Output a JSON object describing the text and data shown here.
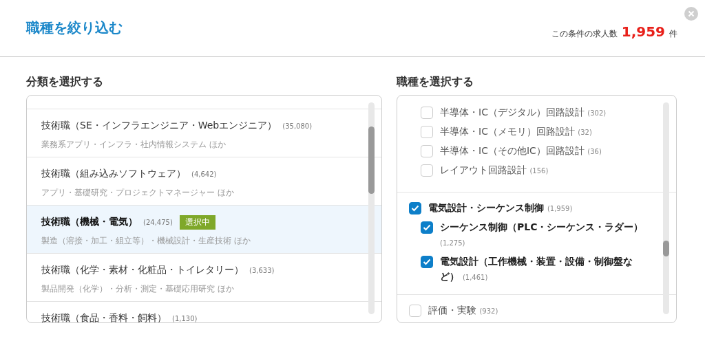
{
  "dialog": {
    "title": "職種を絞り込む",
    "result": {
      "label": "この条件の求人数",
      "count": "1,959",
      "unit": "件"
    }
  },
  "categories": {
    "heading": "分類を選択する",
    "items": [
      {
        "name": "技術職（SE・インフラエンジニア・Webエンジニア）",
        "count": "(35,080)",
        "examples": "業務系アプリ・インフラ・社内情報システム ほか",
        "selected": false
      },
      {
        "name": "技術職（組み込みソフトウェア）",
        "count": "(4,642)",
        "examples": "アプリ・基礎研究・プロジェクトマネージャー ほか",
        "selected": false
      },
      {
        "name": "技術職（機械・電気）",
        "count": "(24,475)",
        "examples": "製造（溶接・加工・組立等）・機械設計・生産技術 ほか",
        "selected": true,
        "badge": "選択中"
      },
      {
        "name": "技術職（化学・素材・化粧品・トイレタリー）",
        "count": "(3,633)",
        "examples": "製品開発（化学）・分析・測定・基礎応用研究 ほか",
        "selected": false
      },
      {
        "name": "技術職（食品・香料・飼料）",
        "count": "(1,130)",
        "selected": false
      }
    ]
  },
  "occupations": {
    "heading": "職種を選択する",
    "groups": [
      {
        "items": [
          {
            "children": [
              {
                "label": "半導体・IC（デジタル）回路設計",
                "count": "(302)",
                "checked": false
              },
              {
                "label": "半導体・IC（メモリ）回路設計",
                "count": "(32)",
                "checked": false
              },
              {
                "label": "半導体・IC（その他IC）回路設計",
                "count": "(36)",
                "checked": false
              },
              {
                "label": "レイアウト回路設計",
                "count": "(156)",
                "checked": false
              }
            ]
          }
        ]
      },
      {
        "items": [
          {
            "label": "電気設計・シーケンス制御",
            "count": "(1,959)",
            "checked": true,
            "children": [
              {
                "label": "シーケンス制御（PLC・シーケンス・ラダー）",
                "count": "(1,275)",
                "checked": true
              },
              {
                "label": "電気設計（工作機械・装置・設備・制御盤など）",
                "count": "(1,461)",
                "checked": true
              }
            ]
          }
        ]
      },
      {
        "items": [
          {
            "label": "評価・実験",
            "count": "(932)",
            "checked": false
          }
        ]
      }
    ]
  }
}
